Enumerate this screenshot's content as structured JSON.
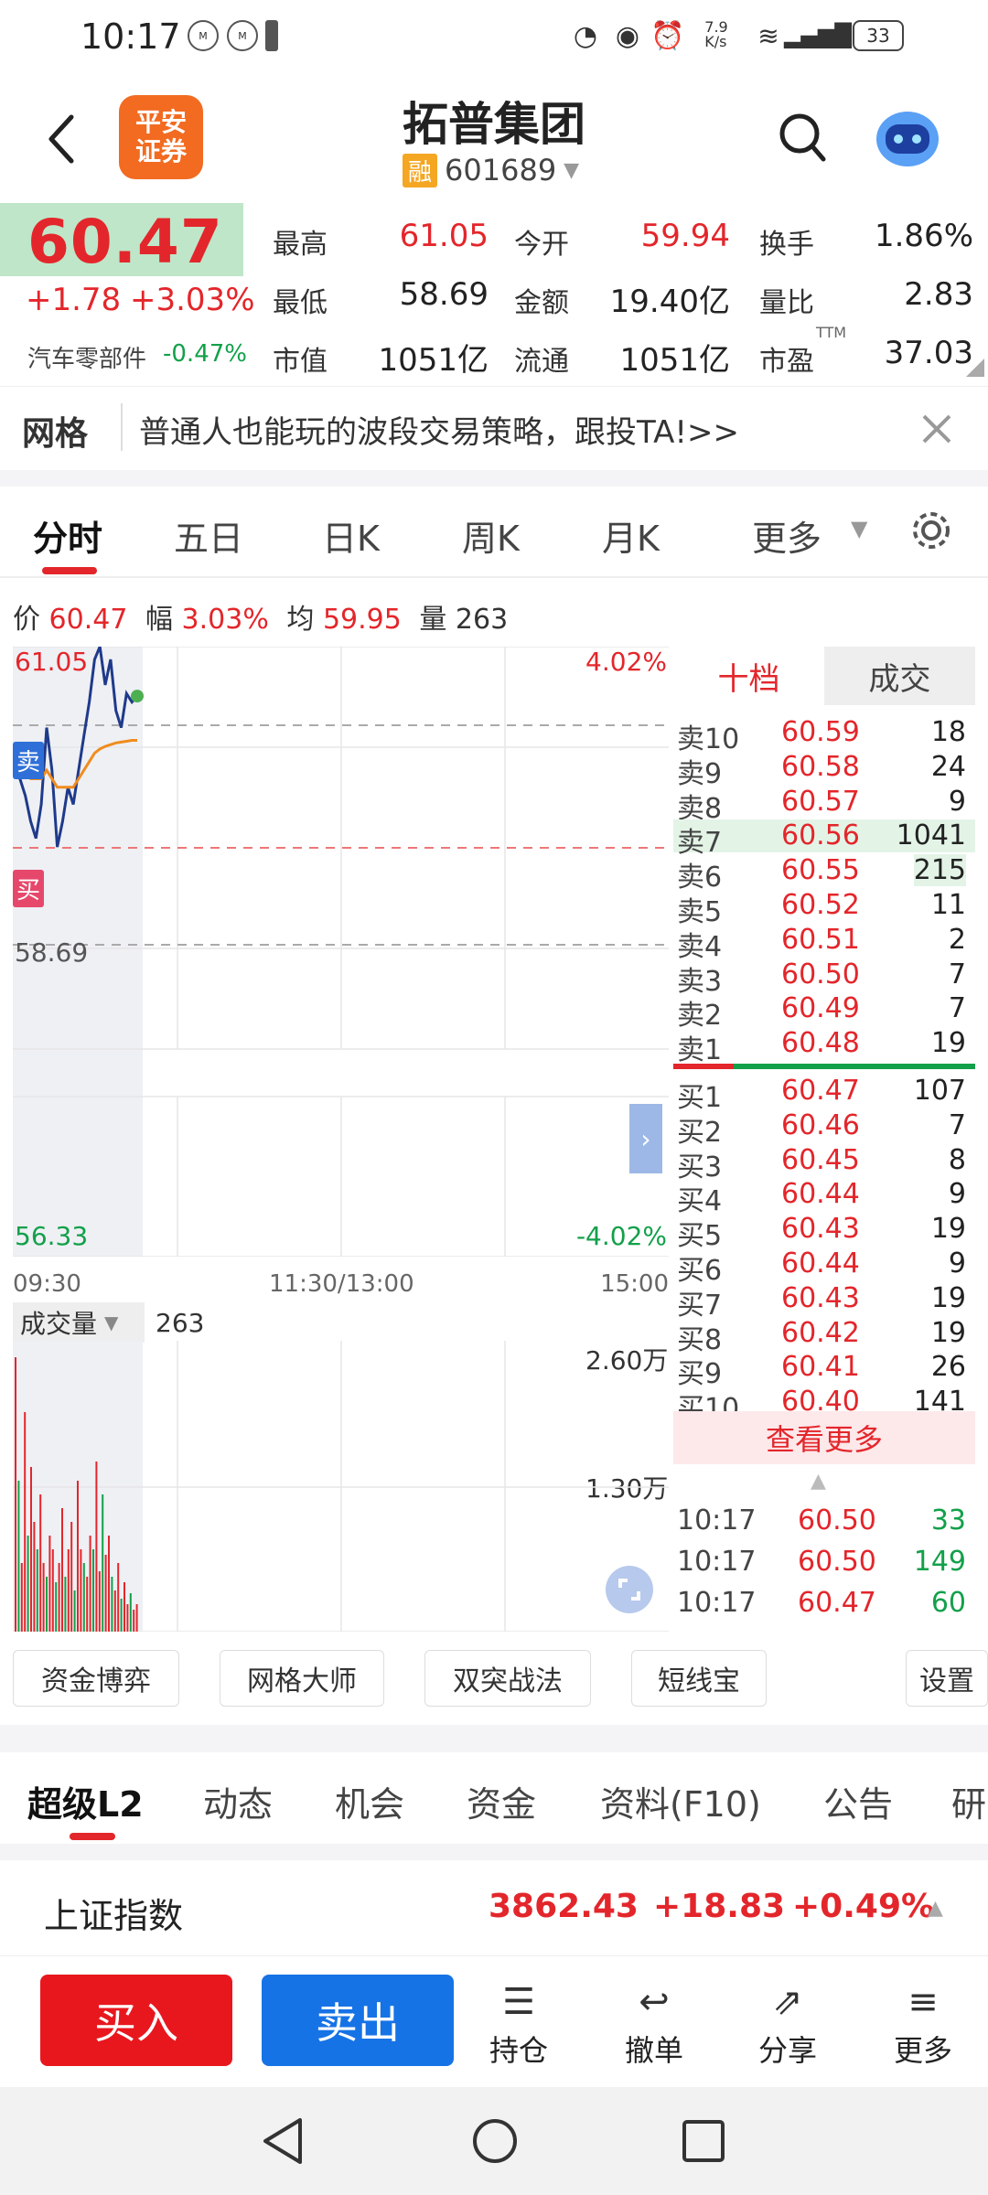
{
  "status": {
    "time": "10:17",
    "speed": "7.9\nK/s",
    "battery": "33"
  },
  "header": {
    "title": "拓普集团",
    "margin_badge": "融",
    "code": "601689",
    "logo_text": [
      "平安",
      "证券"
    ]
  },
  "quote": {
    "price": "60.47",
    "change": "+1.78",
    "change_pct": "+3.03%",
    "sector": "汽车零部件",
    "sector_pct": "-0.47%",
    "high_label": "最高",
    "high": "61.05",
    "open_label": "今开",
    "open": "59.94",
    "turnover_label": "换手",
    "turnover": "1.86%",
    "low_label": "最低",
    "low": "58.69",
    "amount_label": "金额",
    "amount": "19.40亿",
    "vol_ratio_label": "量比",
    "vol_ratio": "2.83",
    "mcap_label": "市值",
    "mcap": "1051亿",
    "float_label": "流通",
    "float": "1051亿",
    "pe_label": "市盈",
    "pe_sup": "TTM",
    "pe": "37.03"
  },
  "banner": {
    "tag": "网格",
    "text": "普通人也能玩的波段交易策略，跟投TA!>>"
  },
  "chart_tabs": [
    "分时",
    "五日",
    "日K",
    "周K",
    "月K",
    "更多"
  ],
  "info": {
    "price_label": "价",
    "price": "60.47",
    "amp_label": "幅",
    "amp": "3.03%",
    "avg_label": "均",
    "avg": "59.95",
    "vol_label": "量",
    "vol": "263"
  },
  "chart": {
    "top_price": "61.05",
    "top_pct": "4.02%",
    "mid_price": "58.69",
    "bottom_price": "56.33",
    "bottom_pct": "-4.02%",
    "times": [
      "09:30",
      "11:30/13:00",
      "15:00"
    ],
    "sell_badge": "卖",
    "buy_badge": "买",
    "vol_dropdown": "成交量",
    "vol_value": "263",
    "vol_high": "2.60万",
    "vol_mid": "1.30万"
  },
  "chart_data": {
    "type": "line",
    "title": "",
    "ylim": [
      56.33,
      61.05
    ],
    "series": [
      {
        "values": [
          59.9,
          59.5,
          59.3,
          59.0,
          58.8,
          59.2,
          60.1,
          59.6,
          58.7,
          59.0,
          59.4,
          59.2,
          59.6,
          60.0,
          60.4,
          60.9,
          61.05,
          60.6,
          60.9,
          60.3,
          60.1,
          60.5,
          60.4,
          60.47
        ]
      },
      {
        "values": [
          59.8,
          59.7,
          59.6,
          59.5,
          59.5,
          59.5,
          59.6,
          59.5,
          59.4,
          59.4,
          59.4,
          59.4,
          59.5,
          59.6,
          59.7,
          59.8,
          59.85,
          59.88,
          59.9,
          59.92,
          59.93,
          59.94,
          59.95,
          59.95
        ]
      }
    ]
  },
  "orderbook": {
    "tab_active": "十档",
    "tab_other": "成交",
    "asks": [
      {
        "l": "卖10",
        "p": "60.59",
        "q": "18"
      },
      {
        "l": "卖9",
        "p": "60.58",
        "q": "24"
      },
      {
        "l": "卖8",
        "p": "60.57",
        "q": "9"
      },
      {
        "l": "卖7",
        "p": "60.56",
        "q": "1041"
      },
      {
        "l": "卖6",
        "p": "60.55",
        "q": "215"
      },
      {
        "l": "卖5",
        "p": "60.52",
        "q": "11"
      },
      {
        "l": "卖4",
        "p": "60.51",
        "q": "2"
      },
      {
        "l": "卖3",
        "p": "60.50",
        "q": "7"
      },
      {
        "l": "卖2",
        "p": "60.49",
        "q": "7"
      },
      {
        "l": "卖1",
        "p": "60.48",
        "q": "19"
      }
    ],
    "bids": [
      {
        "l": "买1",
        "p": "60.47",
        "q": "107"
      },
      {
        "l": "买2",
        "p": "60.46",
        "q": "7"
      },
      {
        "l": "买3",
        "p": "60.45",
        "q": "8"
      },
      {
        "l": "买4",
        "p": "60.44",
        "q": "9"
      },
      {
        "l": "买5",
        "p": "60.43",
        "q": "19"
      },
      {
        "l": "买6",
        "p": "60.44",
        "q": "9"
      },
      {
        "l": "买7",
        "p": "60.43",
        "q": "19"
      },
      {
        "l": "买8",
        "p": "60.42",
        "q": "19"
      },
      {
        "l": "买9",
        "p": "60.41",
        "q": "26"
      },
      {
        "l": "买10",
        "p": "60.40",
        "q": "141"
      }
    ],
    "more": "查看更多",
    "ticks": [
      {
        "t": "10:17",
        "p": "60.50",
        "q": "33"
      },
      {
        "t": "10:17",
        "p": "60.50",
        "q": "149"
      },
      {
        "t": "10:17",
        "p": "60.47",
        "q": "60"
      }
    ]
  },
  "func_buttons": [
    "资金博弈",
    "网格大师",
    "双突战法",
    "短线宝",
    "设置"
  ],
  "info_tabs": [
    "超级L2",
    "动态",
    "机会",
    "资金",
    "资料(F10)",
    "公告",
    "研"
  ],
  "index": {
    "name": "上证指数",
    "value": "3862.43",
    "change": "+18.83",
    "pct": "+0.49%"
  },
  "bottom": {
    "buy": "买入",
    "sell": "卖出",
    "hold": "持仓",
    "cancel": "撤单",
    "share": "分享",
    "more": "更多"
  },
  "colors": {
    "red": "#e3262b",
    "green": "#13a04a",
    "blue": "#1673e6"
  }
}
